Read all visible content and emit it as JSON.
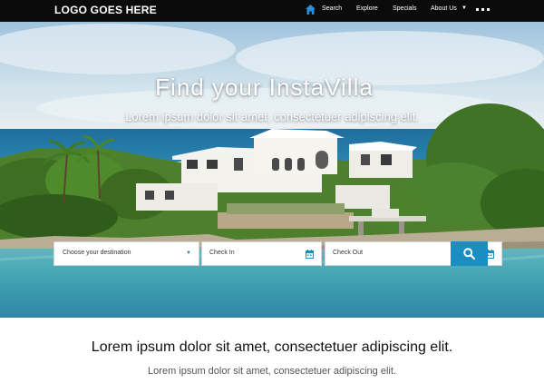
{
  "header": {
    "logo": "LOGO GOES HERE",
    "nav": {
      "home_icon": "home-icon",
      "search": "Search",
      "explore": "Explore",
      "specials": "Specials",
      "about": "About Us",
      "about_caret": "▼",
      "more_icon": "more-dots-icon"
    }
  },
  "hero": {
    "title": "Find your InstaVilla",
    "subtitle": "Lorem ipsum dolor sit amet, consectetuer adipiscing elit."
  },
  "search": {
    "destination": "Choose your destination",
    "destination_arrow": "▼",
    "check_in": "Check In",
    "check_out": "Check Out",
    "button_icon": "search-icon"
  },
  "content": {
    "title": "Lorem ipsum dolor sit amet, consectetuer adipiscing elit.",
    "subtitle": "Lorem ipsum dolor sit amet, consectetuer adipiscing elit."
  },
  "colors": {
    "topbar": "#0b0b0b",
    "accent": "#1a8dc2",
    "home_icon": "#2a8fd6"
  }
}
